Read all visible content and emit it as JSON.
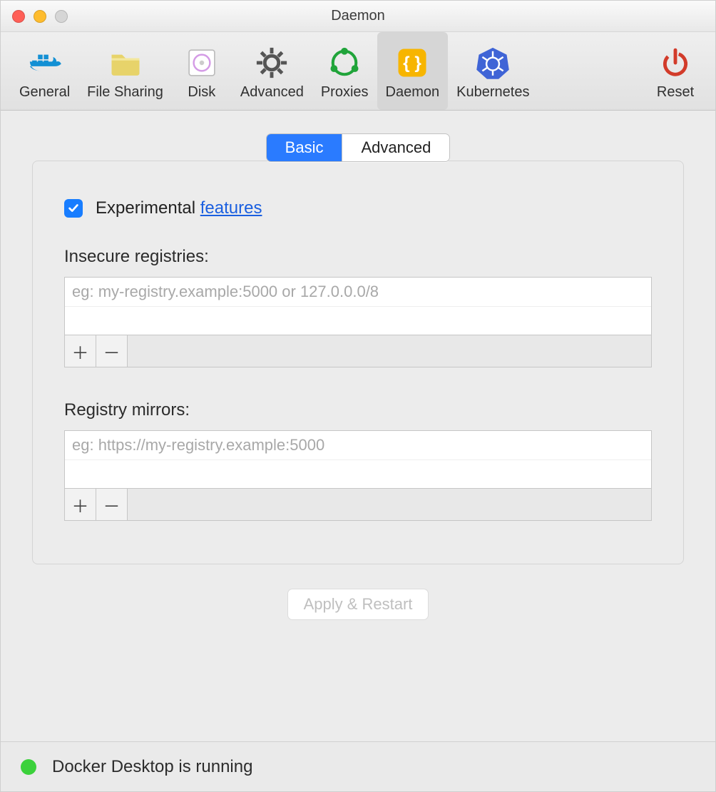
{
  "window": {
    "title": "Daemon"
  },
  "toolbar": {
    "items": [
      {
        "label": "General"
      },
      {
        "label": "File Sharing"
      },
      {
        "label": "Disk"
      },
      {
        "label": "Advanced"
      },
      {
        "label": "Proxies"
      },
      {
        "label": "Daemon"
      },
      {
        "label": "Kubernetes"
      }
    ],
    "reset_label": "Reset"
  },
  "segmented": {
    "basic": "Basic",
    "advanced": "Advanced"
  },
  "experimental": {
    "label_pre": "Experimental ",
    "link": "features",
    "checked": true
  },
  "insecure": {
    "label": "Insecure registries:",
    "placeholder": "eg: my-registry.example:5000 or 127.0.0.0/8"
  },
  "mirrors": {
    "label": "Registry mirrors:",
    "placeholder": "eg: https://my-registry.example:5000"
  },
  "buttons": {
    "apply": "Apply & Restart"
  },
  "status": {
    "text": "Docker Desktop is running"
  }
}
